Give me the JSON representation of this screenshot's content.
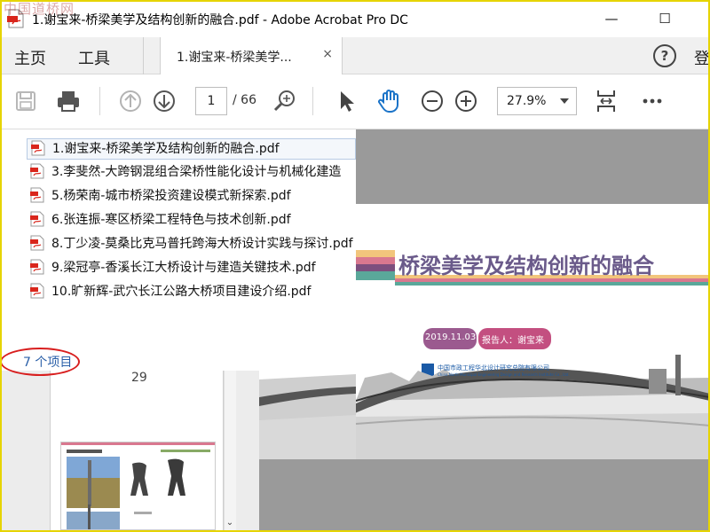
{
  "window": {
    "title": "1.谢宝来-桥梁美学及结构创新的融合.pdf - Adobe Acrobat Pro DC",
    "minimize_glyph": "—",
    "maximize_glyph": "☐",
    "watermark": "中国道桥网"
  },
  "tabs": {
    "home": "主页",
    "tools": "工具",
    "doc_tab": "1.谢宝来-桥梁美学...",
    "close_glyph": "×",
    "help": "?",
    "signin": "登"
  },
  "toolbar": {
    "page_current": "1",
    "page_total": "/ 66",
    "zoom": "27.9%",
    "icons": [
      "save-icon",
      "print-icon",
      "page-up-icon",
      "page-down-icon",
      "zoom-search-icon",
      "select-arrow-icon",
      "hand-icon",
      "zoom-out-icon",
      "zoom-in-icon",
      "fit-page-icon",
      "more-icon"
    ]
  },
  "files": [
    "1.谢宝来-桥梁美学及结构创新的融合.pdf",
    "3.李斐然-大跨钢混组合梁桥性能化设计与机械化建造",
    "5.杨荣南-城市桥梁投资建设模式新探索.pdf",
    "6.张连振-寒区桥梁工程特色与技术创新.pdf",
    "8.丁少凌-莫桑比克马普托跨海大桥设计实践与探讨.pdf",
    "9.梁冠亭-香溪长江大桥设计与建造关键技术.pdf",
    "10.旷新辉-武穴长江公路大桥项目建设介绍.pdf"
  ],
  "item_count": "7 个项目",
  "thumbnail": {
    "page_number": "29"
  },
  "slide": {
    "title": "桥梁美学及结构创新的融合",
    "date": "2019.11.03",
    "reporter": "报告人：谢宝来",
    "org_cn": "中国市政工程华北设计研究总院有限公司",
    "org_en": "China North Municipal Engineering Design and Research Institute Co., Ltd."
  },
  "colors": {
    "stripe1": "#f2c57c",
    "stripe2": "#d9788f",
    "stripe3": "#7d4f7e",
    "stripe4": "#5aa89a",
    "date_badge": "#9b5a8f",
    "reporter_badge": "#c34f80",
    "red_annotation": "#d81e1e",
    "accent_blue": "#2a5fa8"
  }
}
